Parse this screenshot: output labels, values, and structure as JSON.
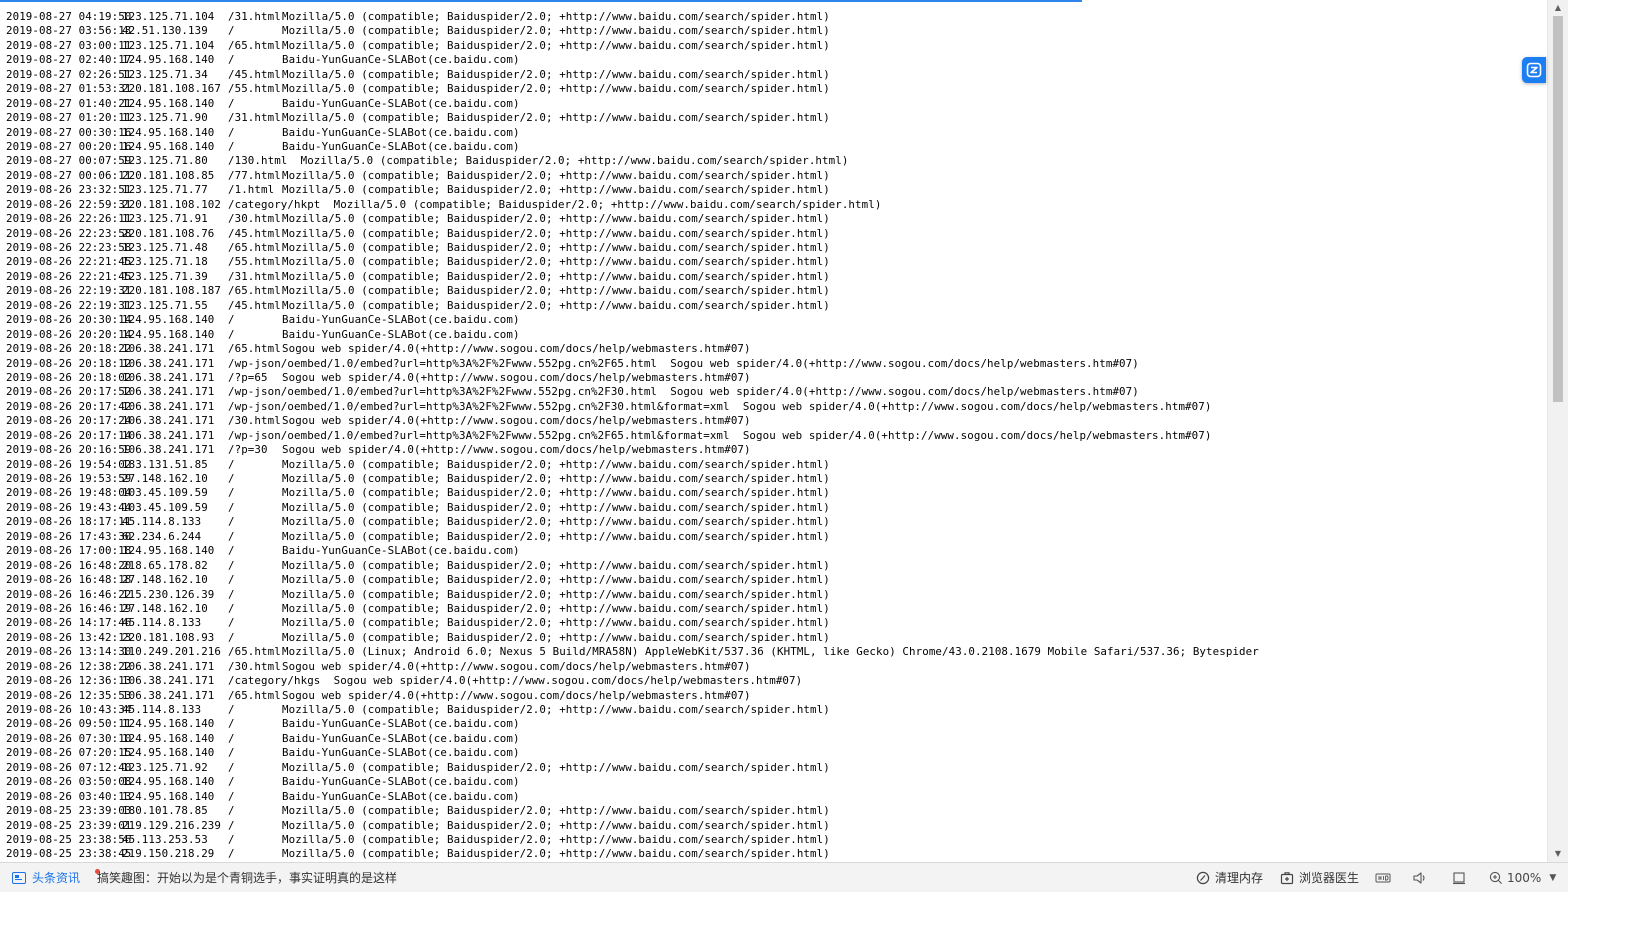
{
  "log_rows": [
    [
      "2019-08-27 04:19:50",
      "123.125.71.104",
      "/31.html",
      "Mozilla/5.0 (compatible; Baiduspider/2.0; +http://www.baidu.com/search/spider.html)"
    ],
    [
      "2019-08-27 03:56:13",
      "42.51.130.139",
      "/",
      "Mozilla/5.0 (compatible; Baiduspider/2.0; +http://www.baidu.com/search/spider.html)"
    ],
    [
      "2019-08-27 03:00:11",
      "123.125.71.104",
      "/65.html",
      "Mozilla/5.0 (compatible; Baiduspider/2.0; +http://www.baidu.com/search/spider.html)"
    ],
    [
      "2019-08-27 02:40:17",
      "124.95.168.140",
      "/",
      "Baidu-YunGuanCe-SLABot(ce.baidu.com)"
    ],
    [
      "2019-08-27 02:26:51",
      "123.125.71.34",
      "/45.html",
      "Mozilla/5.0 (compatible; Baiduspider/2.0; +http://www.baidu.com/search/spider.html)"
    ],
    [
      "2019-08-27 01:53:31",
      "220.181.108.167",
      "/55.html",
      "Mozilla/5.0 (compatible; Baiduspider/2.0; +http://www.baidu.com/search/spider.html)"
    ],
    [
      "2019-08-27 01:40:21",
      "124.95.168.140",
      "/",
      "Baidu-YunGuanCe-SLABot(ce.baidu.com)"
    ],
    [
      "2019-08-27 01:20:11",
      "123.125.71.90",
      "/31.html",
      "Mozilla/5.0 (compatible; Baiduspider/2.0; +http://www.baidu.com/search/spider.html)"
    ],
    [
      "2019-08-27 00:30:16",
      "124.95.168.140",
      "/",
      "Baidu-YunGuanCe-SLABot(ce.baidu.com)"
    ],
    [
      "2019-08-27 00:20:16",
      "124.95.168.140",
      "/",
      "Baidu-YunGuanCe-SLABot(ce.baidu.com)"
    ],
    [
      "2019-08-27 00:07:59",
      "123.125.71.80",
      "/130.html",
      "Mozilla/5.0 (compatible; Baiduspider/2.0; +http://www.baidu.com/search/spider.html)"
    ],
    [
      "2019-08-27 00:06:11",
      "220.181.108.85",
      "/77.html",
      "Mozilla/5.0 (compatible; Baiduspider/2.0; +http://www.baidu.com/search/spider.html)"
    ],
    [
      "2019-08-26 23:32:51",
      "123.125.71.77",
      "/1.html",
      "Mozilla/5.0 (compatible; Baiduspider/2.0; +http://www.baidu.com/search/spider.html)"
    ],
    [
      "2019-08-26 22:59:31",
      "220.181.108.102",
      "/category/hkpt",
      "Mozilla/5.0 (compatible; Baiduspider/2.0; +http://www.baidu.com/search/spider.html)"
    ],
    [
      "2019-08-26 22:26:11",
      "123.125.71.91",
      "/30.html",
      "Mozilla/5.0 (compatible; Baiduspider/2.0; +http://www.baidu.com/search/spider.html)"
    ],
    [
      "2019-08-26 22:23:58",
      "220.181.108.76",
      "/45.html",
      "Mozilla/5.0 (compatible; Baiduspider/2.0; +http://www.baidu.com/search/spider.html)"
    ],
    [
      "2019-08-26 22:23:58",
      "123.125.71.48",
      "/65.html",
      "Mozilla/5.0 (compatible; Baiduspider/2.0; +http://www.baidu.com/search/spider.html)"
    ],
    [
      "2019-08-26 22:21:45",
      "123.125.71.18",
      "/55.html",
      "Mozilla/5.0 (compatible; Baiduspider/2.0; +http://www.baidu.com/search/spider.html)"
    ],
    [
      "2019-08-26 22:21:45",
      "123.125.71.39",
      "/31.html",
      "Mozilla/5.0 (compatible; Baiduspider/2.0; +http://www.baidu.com/search/spider.html)"
    ],
    [
      "2019-08-26 22:19:31",
      "220.181.108.187",
      "/65.html",
      "Mozilla/5.0 (compatible; Baiduspider/2.0; +http://www.baidu.com/search/spider.html)"
    ],
    [
      "2019-08-26 22:19:31",
      "123.125.71.55",
      "/45.html",
      "Mozilla/5.0 (compatible; Baiduspider/2.0; +http://www.baidu.com/search/spider.html)"
    ],
    [
      "2019-08-26 20:30:14",
      "124.95.168.140",
      "/",
      "Baidu-YunGuanCe-SLABot(ce.baidu.com)"
    ],
    [
      "2019-08-26 20:20:14",
      "124.95.168.140",
      "/",
      "Baidu-YunGuanCe-SLABot(ce.baidu.com)"
    ],
    [
      "2019-08-26 20:18:22",
      "106.38.241.171",
      "/65.html",
      "Sogou web spider/4.0(+http://www.sogou.com/docs/help/webmasters.htm#07)"
    ],
    [
      "2019-08-26 20:18:12",
      "106.38.241.171",
      "/wp-json/oembed/1.0/embed?url=http%3A%2F%2Fwww.552pg.cn%2F65.html",
      "Sogou web spider/4.0(+http://www.sogou.com/docs/help/webmasters.htm#07)"
    ],
    [
      "2019-08-26 20:18:02",
      "106.38.241.171",
      "/?p=65",
      "Sogou web spider/4.0(+http://www.sogou.com/docs/help/webmasters.htm#07)"
    ],
    [
      "2019-08-26 20:17:52",
      "106.38.241.171",
      "/wp-json/oembed/1.0/embed?url=http%3A%2F%2Fwww.552pg.cn%2F30.html",
      "Sogou web spider/4.0(+http://www.sogou.com/docs/help/webmasters.htm#07)"
    ],
    [
      "2019-08-26 20:17:42",
      "106.38.241.171",
      "/wp-json/oembed/1.0/embed?url=http%3A%2F%2Fwww.552pg.cn%2F30.html&format=xml",
      "Sogou web spider/4.0(+http://www.sogou.com/docs/help/webmasters.htm#07)"
    ],
    [
      "2019-08-26 20:17:24",
      "106.38.241.171",
      "/30.html",
      "Sogou web spider/4.0(+http://www.sogou.com/docs/help/webmasters.htm#07)"
    ],
    [
      "2019-08-26 20:17:14",
      "106.38.241.171",
      "/wp-json/oembed/1.0/embed?url=http%3A%2F%2Fwww.552pg.cn%2F65.html&format=xml",
      "Sogou web spider/4.0(+http://www.sogou.com/docs/help/webmasters.htm#07)"
    ],
    [
      "2019-08-26 20:16:59",
      "106.38.241.171",
      "/?p=30",
      "Sogou web spider/4.0(+http://www.sogou.com/docs/help/webmasters.htm#07)"
    ],
    [
      "2019-08-26 19:54:02",
      "183.131.51.85",
      "/",
      "Mozilla/5.0 (compatible; Baiduspider/2.0; +http://www.baidu.com/search/spider.html)"
    ],
    [
      "2019-08-26 19:53:59",
      "27.148.162.10",
      "/",
      "Mozilla/5.0 (compatible; Baiduspider/2.0; +http://www.baidu.com/search/spider.html)"
    ],
    [
      "2019-08-26 19:48:04",
      "103.45.109.59",
      "/",
      "Mozilla/5.0 (compatible; Baiduspider/2.0; +http://www.baidu.com/search/spider.html)"
    ],
    [
      "2019-08-26 19:43:44",
      "103.45.109.59",
      "/",
      "Mozilla/5.0 (compatible; Baiduspider/2.0; +http://www.baidu.com/search/spider.html)"
    ],
    [
      "2019-08-26 18:17:11",
      "45.114.8.133",
      "/",
      "Mozilla/5.0 (compatible; Baiduspider/2.0; +http://www.baidu.com/search/spider.html)"
    ],
    [
      "2019-08-26 17:43:30",
      "62.234.6.244",
      "/",
      "Mozilla/5.0 (compatible; Baiduspider/2.0; +http://www.baidu.com/search/spider.html)"
    ],
    [
      "2019-08-26 17:00:18",
      "124.95.168.140",
      "/",
      "Baidu-YunGuanCe-SLABot(ce.baidu.com)"
    ],
    [
      "2019-08-26 16:48:20",
      "218.65.178.82",
      "/",
      "Mozilla/5.0 (compatible; Baiduspider/2.0; +http://www.baidu.com/search/spider.html)"
    ],
    [
      "2019-08-26 16:48:18",
      "27.148.162.10",
      "/",
      "Mozilla/5.0 (compatible; Baiduspider/2.0; +http://www.baidu.com/search/spider.html)"
    ],
    [
      "2019-08-26 16:46:22",
      "115.230.126.39",
      "/",
      "Mozilla/5.0 (compatible; Baiduspider/2.0; +http://www.baidu.com/search/spider.html)"
    ],
    [
      "2019-08-26 16:46:19",
      "27.148.162.10",
      "/",
      "Mozilla/5.0 (compatible; Baiduspider/2.0; +http://www.baidu.com/search/spider.html)"
    ],
    [
      "2019-08-26 14:17:46",
      "45.114.8.133",
      "/",
      "Mozilla/5.0 (compatible; Baiduspider/2.0; +http://www.baidu.com/search/spider.html)"
    ],
    [
      "2019-08-26 13:42:13",
      "220.181.108.93",
      "/",
      "Mozilla/5.0 (compatible; Baiduspider/2.0; +http://www.baidu.com/search/spider.html)"
    ],
    [
      "2019-08-26 13:14:30",
      "110.249.201.216",
      "/65.html",
      "Mozilla/5.0 (Linux; Android 6.0; Nexus 5 Build/MRA58N) AppleWebKit/537.36 (KHTML, like Gecko) Chrome/43.0.2108.1679 Mobile Safari/537.36; Bytespider"
    ],
    [
      "2019-08-26 12:38:22",
      "106.38.241.171",
      "/30.html",
      "Sogou web spider/4.0(+http://www.sogou.com/docs/help/webmasters.htm#07)"
    ],
    [
      "2019-08-26 12:36:13",
      "106.38.241.171",
      "/category/hkgs",
      "Sogou web spider/4.0(+http://www.sogou.com/docs/help/webmasters.htm#07)"
    ],
    [
      "2019-08-26 12:35:53",
      "106.38.241.171",
      "/65.html",
      "Sogou web spider/4.0(+http://www.sogou.com/docs/help/webmasters.htm#07)"
    ],
    [
      "2019-08-26 10:43:34",
      "45.114.8.133",
      "/",
      "Mozilla/5.0 (compatible; Baiduspider/2.0; +http://www.baidu.com/search/spider.html)"
    ],
    [
      "2019-08-26 09:50:11",
      "124.95.168.140",
      "/",
      "Baidu-YunGuanCe-SLABot(ce.baidu.com)"
    ],
    [
      "2019-08-26 07:30:10",
      "124.95.168.140",
      "/",
      "Baidu-YunGuanCe-SLABot(ce.baidu.com)"
    ],
    [
      "2019-08-26 07:20:15",
      "124.95.168.140",
      "/",
      "Baidu-YunGuanCe-SLABot(ce.baidu.com)"
    ],
    [
      "2019-08-26 07:12:40",
      "123.125.71.92",
      "/",
      "Mozilla/5.0 (compatible; Baiduspider/2.0; +http://www.baidu.com/search/spider.html)"
    ],
    [
      "2019-08-26 03:50:08",
      "124.95.168.140",
      "/",
      "Baidu-YunGuanCe-SLABot(ce.baidu.com)"
    ],
    [
      "2019-08-26 03:40:13",
      "124.95.168.140",
      "/",
      "Baidu-YunGuanCe-SLABot(ce.baidu.com)"
    ],
    [
      "2019-08-25 23:39:03",
      "180.101.78.85",
      "/",
      "Mozilla/5.0 (compatible; Baiduspider/2.0; +http://www.baidu.com/search/spider.html)"
    ],
    [
      "2019-08-25 23:39:01",
      "219.129.216.239",
      "/",
      "Mozilla/5.0 (compatible; Baiduspider/2.0; +http://www.baidu.com/search/spider.html)"
    ],
    [
      "2019-08-25 23:38:56",
      "45.113.253.53",
      "/",
      "Mozilla/5.0 (compatible; Baiduspider/2.0; +http://www.baidu.com/search/spider.html)"
    ],
    [
      "2019-08-25 23:38:45",
      "219.150.218.29",
      "/",
      "Mozilla/5.0 (compatible; Baiduspider/2.0; +http://www.baidu.com/search/spider.html)"
    ]
  ],
  "statusbar": {
    "news_label": "头条资讯",
    "headline": "搞笑趣图：开始以为是个青铜选手，事实证明真的是这样",
    "clear_memory": "清理内存",
    "browser_doctor": "浏览器医生",
    "zoom": "100%"
  },
  "icons": {
    "translate": "translate-icon",
    "news": "news-icon",
    "clear_memory": "clear-memory-icon",
    "doctor": "browser-doctor-icon",
    "hid": "hid-icon",
    "volume": "volume-icon",
    "window": "window-icon",
    "zoom": "zoom-icon"
  },
  "colors": {
    "accent": "#1a73e8",
    "progress": "#2f86ea",
    "fab": "#1d7ef2",
    "notice_dot": "#e84a3c"
  },
  "load_progress_fraction": 0.7
}
